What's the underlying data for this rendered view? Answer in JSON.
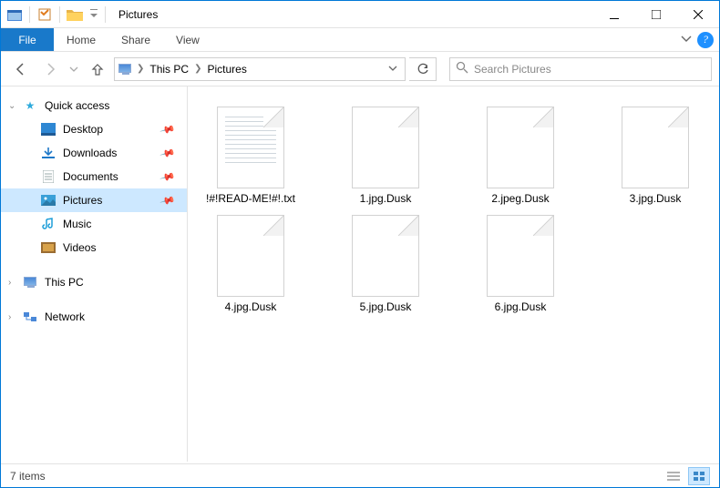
{
  "titlebar": {
    "title": "Pictures"
  },
  "ribbon": {
    "file": "File",
    "tabs": [
      "Home",
      "Share",
      "View"
    ]
  },
  "breadcrumb": {
    "pc": "This PC",
    "folder": "Pictures"
  },
  "search": {
    "placeholder": "Search Pictures"
  },
  "nav": {
    "quickaccess": "Quick access",
    "items": [
      {
        "label": "Desktop",
        "pinned": true
      },
      {
        "label": "Downloads",
        "pinned": true
      },
      {
        "label": "Documents",
        "pinned": true
      },
      {
        "label": "Pictures",
        "pinned": true,
        "selected": true
      },
      {
        "label": "Music",
        "pinned": false
      },
      {
        "label": "Videos",
        "pinned": false
      }
    ],
    "thispc": "This PC",
    "network": "Network"
  },
  "files": [
    {
      "name": "!#!READ-ME!#!.txt",
      "textfile": true
    },
    {
      "name": "1.jpg.Dusk"
    },
    {
      "name": "2.jpeg.Dusk"
    },
    {
      "name": "3.jpg.Dusk"
    },
    {
      "name": "4.jpg.Dusk"
    },
    {
      "name": "5.jpg.Dusk"
    },
    {
      "name": "6.jpg.Dusk"
    }
  ],
  "status": {
    "count": "7 items"
  }
}
